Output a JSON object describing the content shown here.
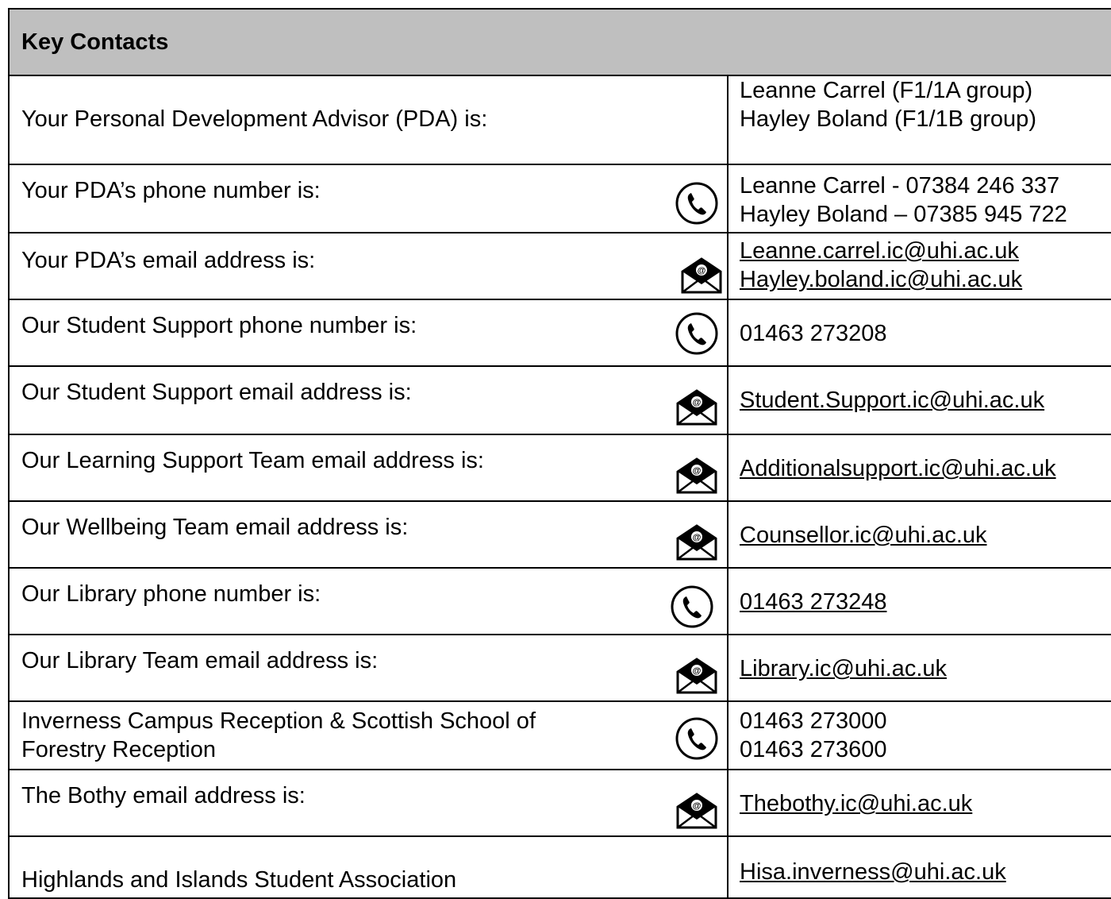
{
  "title": "Key Contacts",
  "rows": [
    {
      "label": [
        "Your Personal Development Advisor (PDA) is:"
      ],
      "icon": "",
      "values": [
        "Leanne Carrel (F1/1A group)",
        "Hayley Boland (F1/1B group)"
      ],
      "links": false
    },
    {
      "label": [
        "Your PDA’s phone number is:"
      ],
      "icon": "phone-icon",
      "values": [
        "Leanne Carrel - 07384 246 337",
        "Hayley Boland – 07385 945 722"
      ],
      "links": false
    },
    {
      "label": [
        "Your PDA’s email address is:"
      ],
      "icon": "email-icon",
      "values": [
        "Leanne.carrel.ic@uhi.ac.uk",
        "Hayley.boland.ic@uhi.ac.uk"
      ],
      "links": true
    },
    {
      "label": [
        "Our Student Support phone number is:"
      ],
      "icon": "phone-icon",
      "values": [
        "01463 273208"
      ],
      "links": false
    },
    {
      "label": [
        "Our Student Support email address is:"
      ],
      "icon": "email-icon",
      "values": [
        "Student.Support.ic@uhi.ac.uk"
      ],
      "links": true
    },
    {
      "label": [
        "Our Learning Support Team email address is:"
      ],
      "icon": "email-icon",
      "values": [
        "Additionalsupport.ic@uhi.ac.uk"
      ],
      "links": true
    },
    {
      "label": [
        "Our Wellbeing Team email address is:"
      ],
      "icon": "email-icon",
      "values": [
        "Counsellor.ic@uhi.ac.uk"
      ],
      "links": true
    },
    {
      "label": [
        "Our Library phone number is:"
      ],
      "icon": "phone-icon",
      "values": [
        "01463 273248"
      ],
      "links": true
    },
    {
      "label": [
        "Our Library Team email address is:"
      ],
      "icon": "email-icon",
      "values": [
        "Library.ic@uhi.ac.uk"
      ],
      "links": true
    },
    {
      "label": [
        "Inverness Campus Reception &  Scottish School of",
        "Forestry Reception"
      ],
      "icon": "phone-icon",
      "values": [
        "01463 273000",
        "01463 273600"
      ],
      "links": false
    },
    {
      "label": [
        "The Bothy email address is:"
      ],
      "icon": "email-icon",
      "values": [
        "Thebothy.ic@uhi.ac.uk"
      ],
      "links": true
    },
    {
      "label": [
        "Highlands and Islands Student Association"
      ],
      "icon": "",
      "values": [
        "Hisa.inverness@uhi.ac.uk"
      ],
      "links": true
    }
  ]
}
